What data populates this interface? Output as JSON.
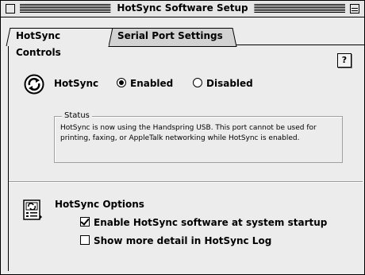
{
  "window": {
    "title": "HotSync Software Setup"
  },
  "tabs": [
    {
      "label": "HotSync Controls",
      "selected": true
    },
    {
      "label": "Serial Port Settings",
      "selected": false
    }
  ],
  "help_button": {
    "label": "?"
  },
  "hotsync": {
    "label": "HotSync",
    "options": [
      {
        "label": "Enabled",
        "selected": true
      },
      {
        "label": "Disabled",
        "selected": false
      }
    ]
  },
  "status": {
    "title": "Status",
    "text": "HotSync is now using the Handspring USB.  This port cannot be used for printing, faxing, or AppleTalk networking while HotSync is enabled."
  },
  "options": {
    "title": "HotSync Options",
    "checkboxes": [
      {
        "label": "Enable HotSync software at system startup",
        "checked": true
      },
      {
        "label": "Show more detail in HotSync Log",
        "checked": false
      }
    ]
  },
  "icons": {
    "hotsync": "hotsync-icon",
    "options": "hotsync-options-icon"
  }
}
